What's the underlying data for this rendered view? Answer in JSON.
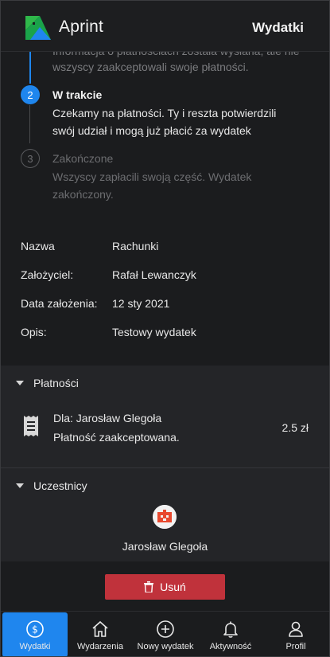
{
  "header": {
    "app_name": "Aprint",
    "page_title": "Wydatki"
  },
  "steps": {
    "previous_text_line1": "Informacja o płatnościach została wysłana, ale nie",
    "previous_text_line2": "wszyscy zaakceptowali swoje płatności.",
    "current": {
      "number": "2",
      "title": "W trakcie",
      "desc_line1": "Czekamy na płatności. Ty i reszta potwierdzili",
      "desc_line2": "swój udział i mogą już płacić za wydatek"
    },
    "next": {
      "number": "3",
      "title": "Zakończone",
      "desc_line1": "Wszyscy zapłacili swoją część. Wydatek",
      "desc_line2": "zakończony."
    }
  },
  "details": [
    {
      "label": "Nazwa",
      "value": "Rachunki"
    },
    {
      "label": "Założyciel:",
      "value": "Rafał Lewanczyk"
    },
    {
      "label": "Data założenia:",
      "value": "12 sty 2021"
    },
    {
      "label": "Opis:",
      "value": "Testowy wydatek"
    }
  ],
  "payments": {
    "title": "Płatności",
    "items": [
      {
        "line1": "Dla: Jarosław Glegoła",
        "line2": "Płatność zaakceptowana.",
        "amount": "2.5 zł"
      }
    ]
  },
  "participants": {
    "title": "Uczestnicy",
    "items": [
      {
        "name": "Jarosław Glegoła"
      }
    ]
  },
  "actions": {
    "delete_label": "Usuń"
  },
  "nav": [
    {
      "label": "Wydatki",
      "icon": "dollar-icon",
      "active": true
    },
    {
      "label": "Wydarzenia",
      "icon": "home-icon",
      "active": false
    },
    {
      "label": "Nowy wydatek",
      "icon": "plus-circle-icon",
      "active": false
    },
    {
      "label": "Aktywność",
      "icon": "bell-icon",
      "active": false
    },
    {
      "label": "Profil",
      "icon": "user-icon",
      "active": false
    }
  ],
  "colors": {
    "accent": "#1f86ee",
    "danger": "#c0323b",
    "background": "#1b1c1e",
    "section_background": "#242528"
  }
}
